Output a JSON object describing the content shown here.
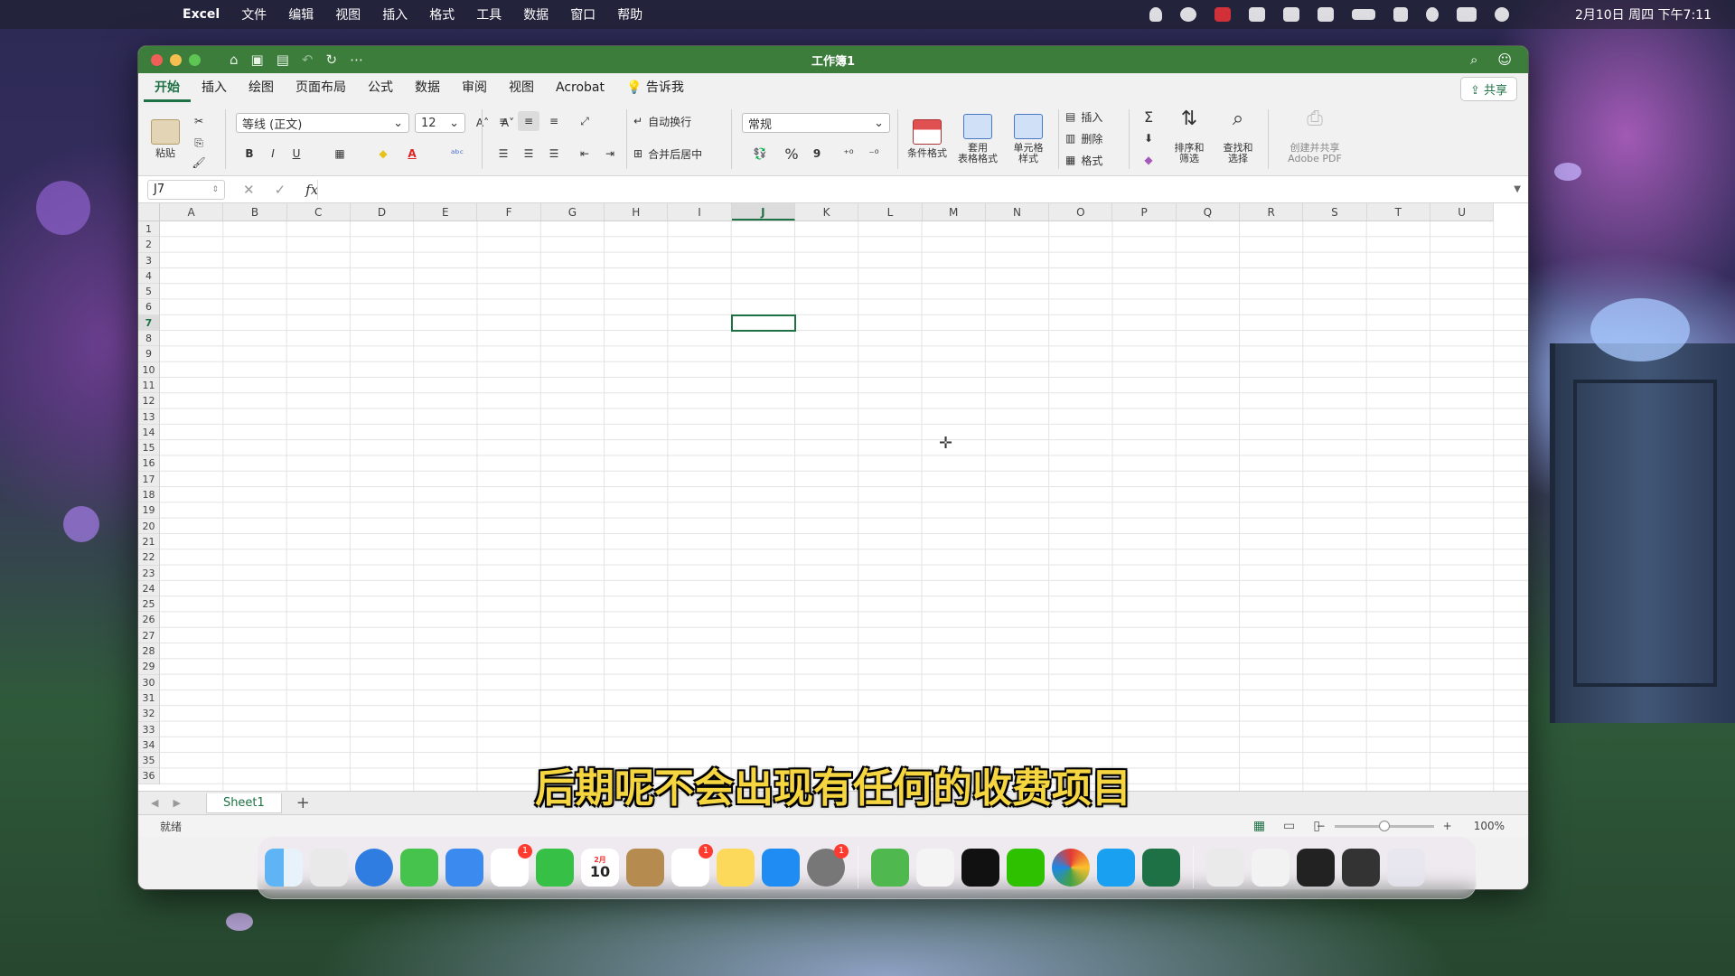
{
  "menubar": {
    "app_name": "Excel",
    "menus": [
      "文件",
      "编辑",
      "视图",
      "插入",
      "格式",
      "工具",
      "数据",
      "窗口",
      "帮助"
    ],
    "clock": "2月10日 周四 下午7:11"
  },
  "window": {
    "title": "工作簿1",
    "tabs": [
      "开始",
      "插入",
      "绘图",
      "页面布局",
      "公式",
      "数据",
      "审阅",
      "视图",
      "Acrobat"
    ],
    "tell_me": "告诉我",
    "share_label": "共享"
  },
  "ribbon": {
    "paste_label": "粘贴",
    "font_name": "等线 (正文)",
    "font_size": "12",
    "bold": "B",
    "italic": "I",
    "underline": "U",
    "wrap_text": "自动换行",
    "merge_center": "合并后居中",
    "number_format": "常规",
    "percent": "%",
    "comma": "9",
    "conditional_format": "条件格式",
    "format_as_table": "套用\n表格格式",
    "cell_styles": "单元格\n样式",
    "insert": "插入",
    "delete": "删除",
    "format": "格式",
    "sort_filter": "排序和\n筛选",
    "find_select": "查找和\n选择",
    "create_share_pdf": "创建并共享\nAdobe PDF"
  },
  "formula_bar": {
    "name_box": "J7",
    "fx_label": "fx",
    "formula": ""
  },
  "grid": {
    "columns": [
      "A",
      "B",
      "C",
      "D",
      "E",
      "F",
      "G",
      "H",
      "I",
      "J",
      "K",
      "L",
      "M",
      "N",
      "O",
      "P",
      "Q",
      "R",
      "S",
      "T",
      "U"
    ],
    "selected_column": "J",
    "rows": [
      "1",
      "2",
      "3",
      "4",
      "5",
      "6",
      "7",
      "8",
      "9",
      "10",
      "11",
      "12",
      "13",
      "14",
      "15",
      "16",
      "17",
      "18",
      "19",
      "20",
      "21",
      "22",
      "23",
      "24",
      "25",
      "26",
      "27",
      "28",
      "29",
      "30",
      "31",
      "32",
      "33",
      "34",
      "35",
      "36"
    ],
    "selected_row": "7"
  },
  "sheets": {
    "tabs": [
      "Sheet1"
    ],
    "add_label": "+"
  },
  "subtitle": "后期呢不会出现有任何的收费项目",
  "status": {
    "ready": "就绪",
    "zoom": "100%",
    "zoom_minus": "−",
    "zoom_plus": "+"
  },
  "dock": {
    "calendar_month": "2月",
    "calendar_day": "10",
    "badges": {
      "photos": "1",
      "reminders": "1",
      "settings": "1"
    }
  },
  "colors": {
    "excel_green": "#1e7145",
    "titlebar_green": "#3c7d3c",
    "subtitle_yellow": "#f5d640"
  }
}
